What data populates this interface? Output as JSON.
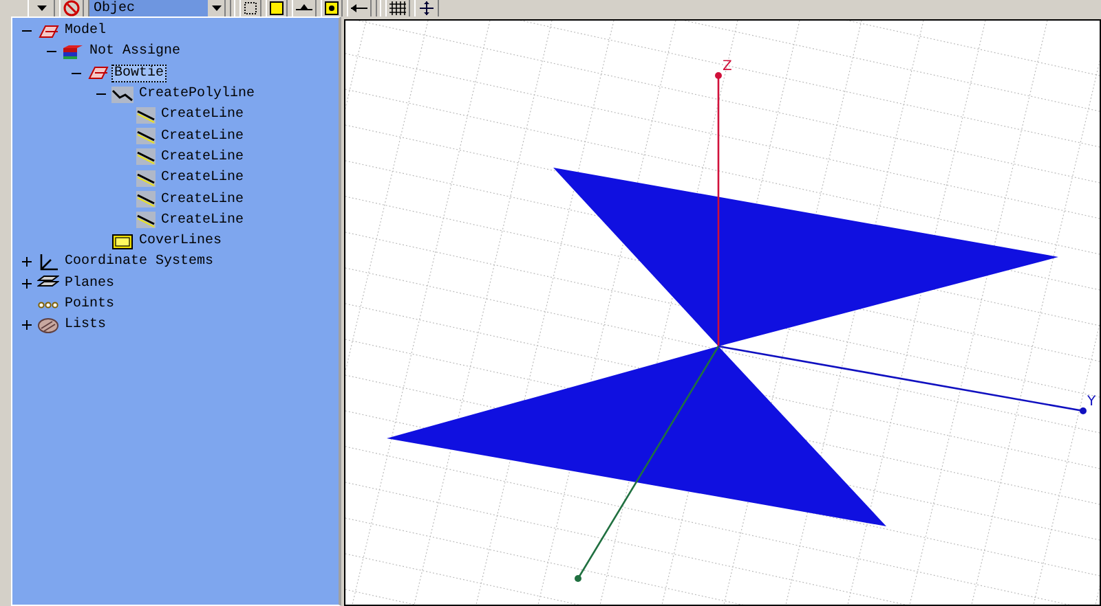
{
  "toolbar": {
    "object_dropdown": {
      "value": "Objec"
    }
  },
  "tree": [
    {
      "label": "Model",
      "kind": "model",
      "expanded": true,
      "selected": false,
      "children": [
        {
          "label": "Not Assigne",
          "kind": "material",
          "expanded": true,
          "selected": false,
          "children": [
            {
              "label": "Bowtie",
              "kind": "object",
              "expanded": true,
              "selected": true,
              "children": [
                {
                  "label": "CreatePolyline",
                  "kind": "polyline",
                  "expanded": true,
                  "selected": false,
                  "children": [
                    {
                      "label": "CreateLine",
                      "kind": "line",
                      "selected": false
                    },
                    {
                      "label": "CreateLine",
                      "kind": "line",
                      "selected": false
                    },
                    {
                      "label": "CreateLine",
                      "kind": "line",
                      "selected": false
                    },
                    {
                      "label": "CreateLine",
                      "kind": "line",
                      "selected": false
                    },
                    {
                      "label": "CreateLine",
                      "kind": "line",
                      "selected": false
                    },
                    {
                      "label": "CreateLine",
                      "kind": "line",
                      "selected": false
                    }
                  ]
                },
                {
                  "label": "CoverLines",
                  "kind": "cover",
                  "selected": false
                }
              ]
            }
          ]
        }
      ]
    },
    {
      "label": "Coordinate Systems",
      "kind": "axes",
      "expanded": false,
      "selected": false
    },
    {
      "label": "Planes",
      "kind": "planes",
      "expanded": false,
      "selected": false
    },
    {
      "label": "Points",
      "kind": "points",
      "selected": false
    },
    {
      "label": "Lists",
      "kind": "lists",
      "expanded": false,
      "selected": false
    }
  ],
  "viewport": {
    "axes": [
      {
        "kind": "z",
        "label": "Z"
      },
      {
        "kind": "y",
        "label": "Y"
      },
      {
        "kind": "x"
      }
    ]
  }
}
